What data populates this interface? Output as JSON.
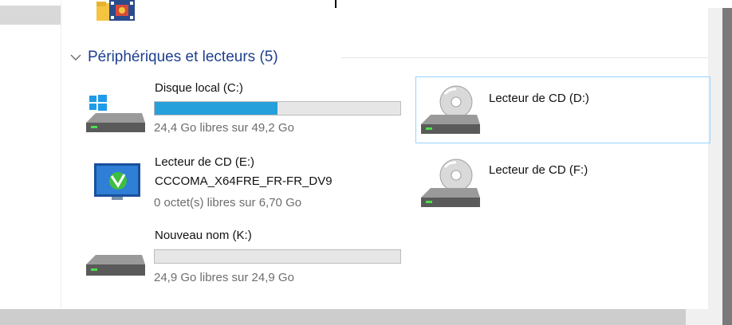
{
  "group": {
    "title": "Périphériques et lecteurs (5)",
    "chevron_icon": "chevron-down-icon"
  },
  "drives": [
    {
      "name": "Disque local (C:)",
      "free_text": "24,4 Go libres sur 49,2 Go",
      "used_fraction": 0.5,
      "icon": "windows-hdd-icon"
    },
    {
      "name": "Lecteur de CD (D:)",
      "icon": "cd-drive-icon"
    },
    {
      "name": "Lecteur de CD (E:)",
      "volume_label": "CCCOMA_X64FRE_FR-FR_DV9",
      "free_text": "0 octet(s) libres sur 6,70 Go",
      "icon": "dvd-setup-icon"
    },
    {
      "name": "Lecteur de CD (F:)",
      "icon": "cd-drive-icon"
    },
    {
      "name": "Nouveau nom (K:)",
      "free_text": "24,9 Go libres sur 24,9 Go",
      "used_fraction": 0.0,
      "icon": "hdd-icon"
    }
  ],
  "colors": {
    "accent": "#26a0da",
    "header_text": "#1e3f8f",
    "selection_border": "#99d1ff"
  }
}
